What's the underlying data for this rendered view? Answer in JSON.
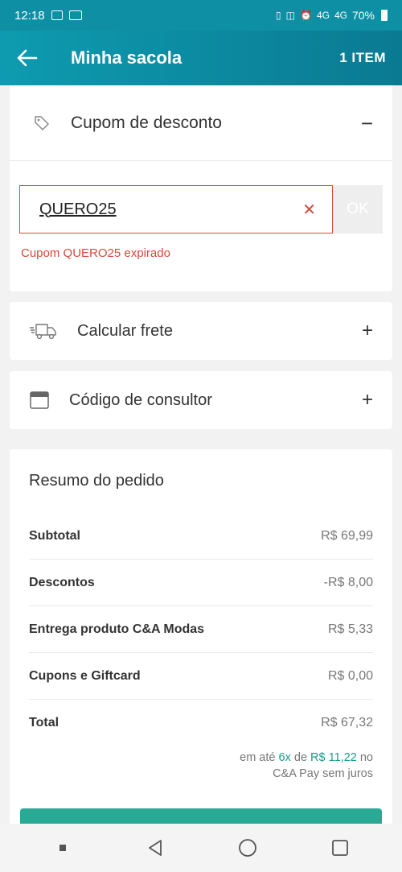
{
  "status_bar": {
    "time": "12:18",
    "battery_percent": "70%",
    "network_labels": [
      "4G",
      "4G"
    ]
  },
  "app_bar": {
    "title": "Minha sacola",
    "item_count": "1 ITEM"
  },
  "coupon": {
    "title": "Cupom de desconto",
    "code": "QUERO25",
    "ok_label": "OK",
    "error": "Cupom QUERO25 expirado"
  },
  "shipping": {
    "title": "Calcular frete"
  },
  "consultant": {
    "title": "Código de consultor"
  },
  "summary": {
    "title": "Resumo do pedido",
    "rows": [
      {
        "label": "Subtotal",
        "value": "R$ 69,99"
      },
      {
        "label": "Descontos",
        "value": "-R$ 8,00"
      },
      {
        "label": "Entrega produto C&A Modas",
        "value": "R$ 5,33"
      },
      {
        "label": "Cupons e Giftcard",
        "value": "R$ 0,00"
      },
      {
        "label": "Total",
        "value": "R$ 67,32"
      }
    ],
    "installments": {
      "prefix": "em até",
      "count": "6x",
      "middle": "de",
      "amount": "R$ 11,22",
      "suffix": "no",
      "line2": "C&A Pay sem juros"
    }
  },
  "colors": {
    "primary": "#0e8fa3",
    "error": "#d9473a",
    "accent": "#2aa995"
  }
}
